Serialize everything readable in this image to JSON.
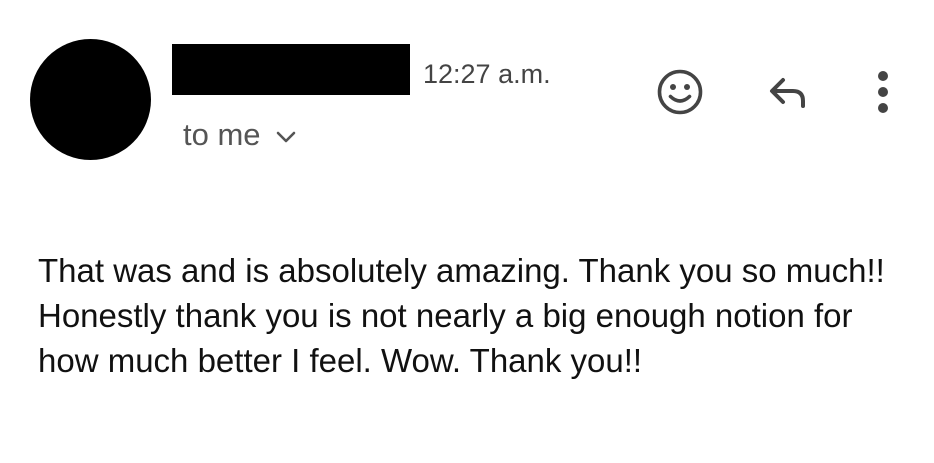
{
  "email": {
    "timestamp": "12:27 a.m.",
    "recipient": "to me",
    "body": "That was and is absolutely amazing. Thank you so much!! Honestly thank you is not nearly a big enough notion for how much better I feel. Wow. Thank you!!"
  },
  "icons": {
    "recipient_details": "chevron-down-icon",
    "react": "smiley-emoji-icon",
    "reply": "reply-arrow-icon",
    "more": "more-vertical-icon"
  },
  "colors": {
    "background": "#ffffff",
    "text": "#111111",
    "secondary_text": "#555555",
    "icon": "#444444",
    "redaction": "#000000"
  }
}
